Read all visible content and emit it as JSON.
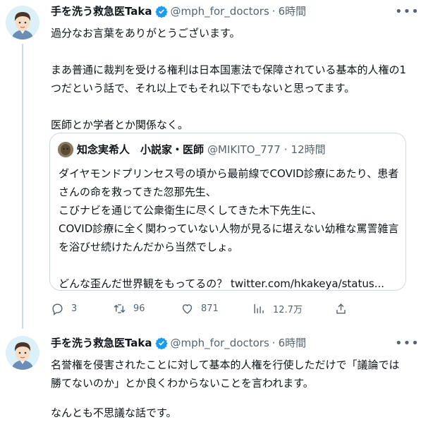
{
  "tweet1": {
    "author_name": "手を洗う救急医Taka",
    "handle": "@mph_for_doctors",
    "dot": "·",
    "time": "6時間",
    "lines": [
      "過分なお言葉をありがとうございます。",
      "",
      "まあ普通に裁判を受ける権利は日本国憲法で保障されている基本的人権の1",
      "つだという話で、それ以上でもそれ以下でもないと思ってます。",
      "",
      "医師とか学者とか関係なく。"
    ],
    "quote": {
      "author_name": "知念実希人　小説家・医師",
      "handle": "@MIKITO_777",
      "dot": "·",
      "time": "12時間",
      "lines": [
        "ダイヤモンドプリンセス号の頃から最前線でCOVID診療にあたり、患者",
        "さんの命を救ってきた忽那先生、",
        "こびナビを通じて公衆衛生に尽くしてきた木下先生に、",
        "COVID診療に全く関わっていない人物が見るに堪えない幼稚な罵詈雑言",
        "を浴びせ続けたんだから当然でしょ。",
        "",
        "どんな歪んだ世界観をもってるの？ twitter.com/hkakeya/status..."
      ]
    },
    "actions": {
      "replies": "3",
      "retweets": "96",
      "likes": "871",
      "views": "12.7万"
    }
  },
  "tweet2": {
    "author_name": "手を洗う救急医Taka",
    "handle": "@mph_for_doctors",
    "dot": "·",
    "time": "6時間",
    "lines": [
      "名誉権を侵害されたことに対して基本的人権を行使しただけで「議論では",
      "勝てないのか」とか良くわからないことを言われます。",
      "",
      "なんとも不思議な話です。"
    ]
  },
  "colors": {
    "verified": "#1d9bf0",
    "secondary_text": "#536471",
    "border": "#cfd9de"
  },
  "icons": {
    "more": "more-icon",
    "reply": "reply-icon",
    "retweet": "retweet-icon",
    "like": "like-icon",
    "views": "views-icon",
    "share": "share-icon",
    "verified": "verified-badge-icon"
  }
}
